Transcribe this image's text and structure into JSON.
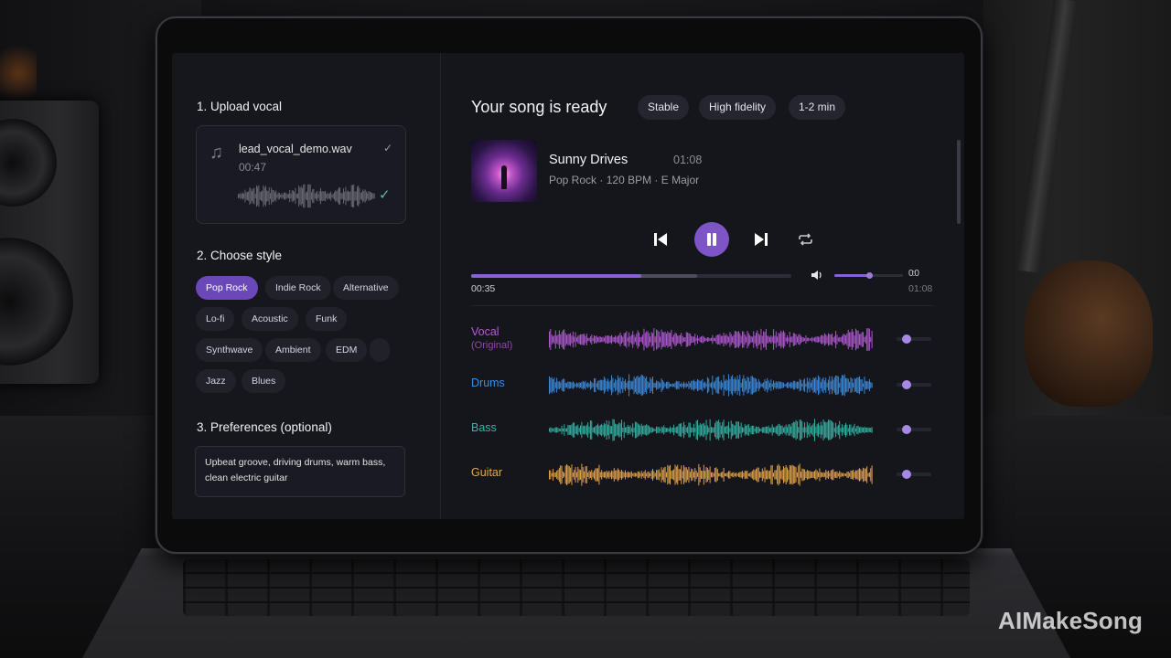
{
  "left_panel": {
    "upload_title": "1. Upload vocal",
    "file": {
      "name": "lead_vocal_demo.wav",
      "duration": "00:47"
    },
    "style_title": "2. Choose style",
    "styles": [
      "Pop Rock",
      "Indie Rock",
      "Alternative",
      "Lo-fi",
      "Acoustic",
      "Funk",
      "Synthwave",
      "Ambient",
      "EDM",
      "",
      "Jazz",
      "Blues"
    ],
    "selected_style": "Pop Rock",
    "prefs_title": "3. Preferences (optional)",
    "prefs_text": "Upbeat groove, driving drums, warm bass, clean electric guitar"
  },
  "player": {
    "heading": "Your song is ready",
    "badges": [
      "Stable",
      "High fidelity",
      "1-2 min"
    ],
    "song": {
      "title": "Sunny Drives",
      "duration": "01:08",
      "genre": "Pop Rock",
      "bpm": "120 BPM",
      "key": "E Major",
      "separator": "·"
    },
    "time_current": "00:35",
    "time_total": "01:08",
    "time_total_alt": "01:08",
    "progress_fraction": 0.74,
    "buffer_fraction": 0.82,
    "volume_fraction": 0.5,
    "volume_label": "0:0"
  },
  "tracks": [
    {
      "name": "Vocal",
      "sub": "(Original)",
      "color": "#b45bd6",
      "level": 0.2
    },
    {
      "name": "Drums",
      "sub": "",
      "color": "#3d8fe0",
      "level": 0.2
    },
    {
      "name": "Bass",
      "sub": "",
      "color": "#34b7a6",
      "level": 0.2
    },
    {
      "name": "Guitar",
      "sub": "",
      "color": "#e9a84a",
      "level": 0.2
    }
  ],
  "icons": {
    "file": "music-note-icon",
    "check": "check-icon",
    "prev": "skip-previous-icon",
    "pause": "pause-icon",
    "next": "skip-next-icon",
    "repeat": "repeat-icon",
    "volume": "volume-icon"
  },
  "watermark": "AIMakeSong"
}
